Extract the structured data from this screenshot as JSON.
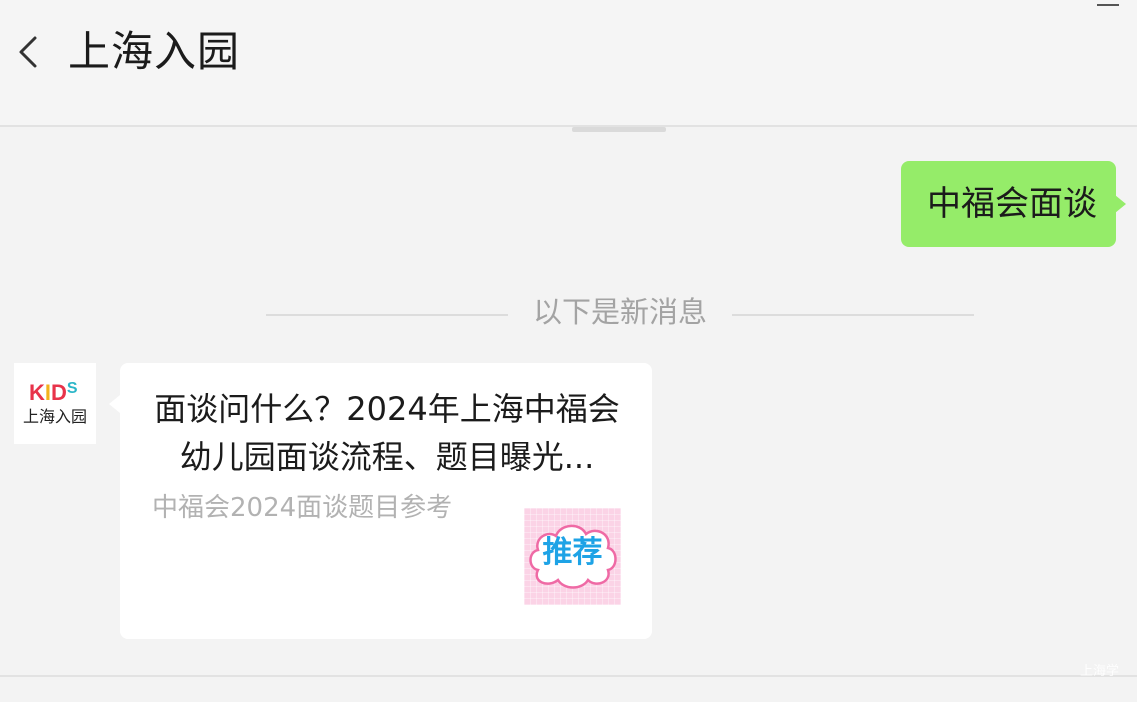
{
  "header": {
    "title": "上海入园",
    "back_icon": "chevron-left-icon",
    "minimize_icon": "minimize-icon"
  },
  "messages": {
    "sent": {
      "text": "中福会面谈",
      "bubble_color": "#95ec69"
    },
    "divider_label": "以下是新消息",
    "received_card": {
      "avatar": {
        "logo_text": "KIDS",
        "name": "上海入园"
      },
      "title": "面谈问什么？2024年上海中福会幼儿园面谈流程、题目曝光...",
      "description": "中福会2024面谈题目参考",
      "thumbnail_label": "推荐"
    }
  },
  "watermark": "上海学"
}
